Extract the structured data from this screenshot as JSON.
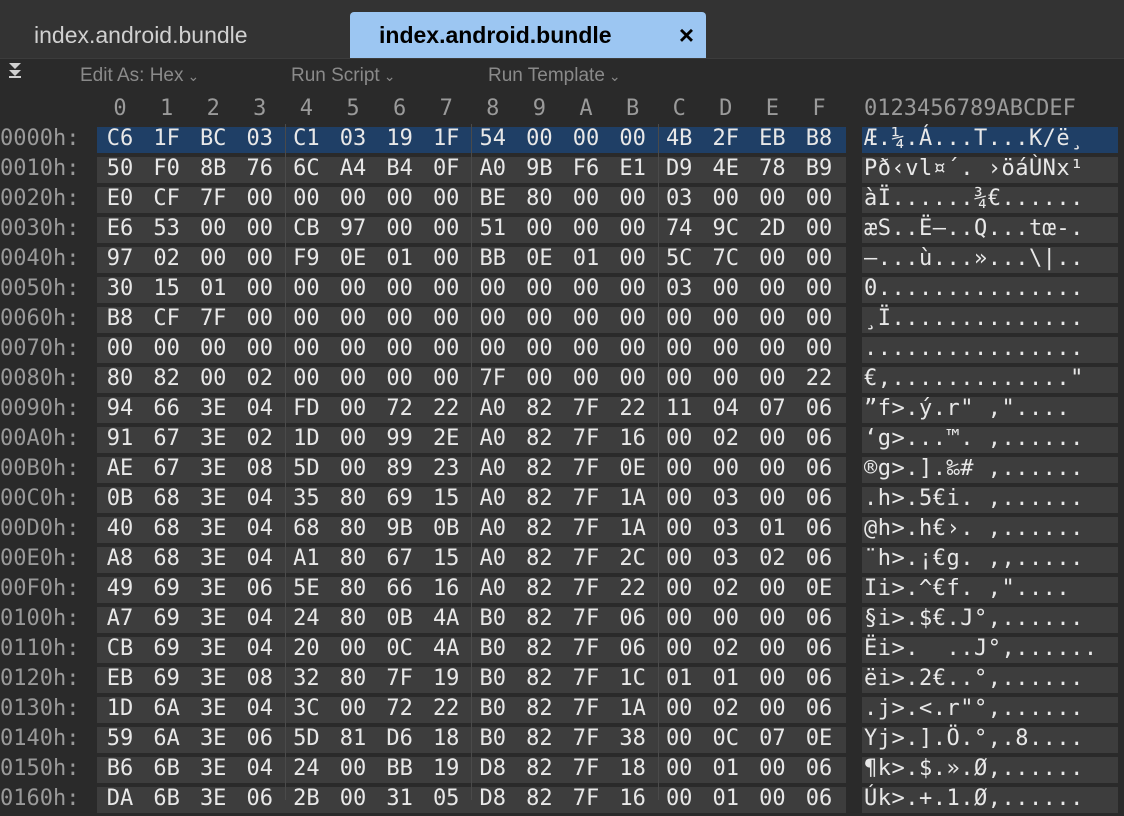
{
  "tabs": [
    {
      "label": "index.android.bundle",
      "active": false
    },
    {
      "label": "index.android.bundle",
      "active": true,
      "close": "×"
    }
  ],
  "toolbar": {
    "collapse_icon": "double-chevron-down-icon",
    "collapse_glyph": "⏬",
    "edit_as": "Edit As: Hex",
    "run_script": "Run Script",
    "run_template": "Run Template",
    "chevron": "⌄"
  },
  "columns": [
    "0",
    "1",
    "2",
    "3",
    "4",
    "5",
    "6",
    "7",
    "8",
    "9",
    "A",
    "B",
    "C",
    "D",
    "E",
    "F"
  ],
  "ascii_header": "0123456789ABCDEF",
  "rows": [
    {
      "addr": "0000h:",
      "bytes": [
        "C6",
        "1F",
        "BC",
        "03",
        "C1",
        "03",
        "19",
        "1F",
        "54",
        "00",
        "00",
        "00",
        "4B",
        "2F",
        "EB",
        "B8"
      ],
      "ascii": "Æ.¼.Á...T...K/ë¸",
      "selected": true
    },
    {
      "addr": "0010h:",
      "bytes": [
        "50",
        "F0",
        "8B",
        "76",
        "6C",
        "A4",
        "B4",
        "0F",
        "A0",
        "9B",
        "F6",
        "E1",
        "D9",
        "4E",
        "78",
        "B9"
      ],
      "ascii": "Pð‹vl¤´. ›öáÙNx¹"
    },
    {
      "addr": "0020h:",
      "bytes": [
        "E0",
        "CF",
        "7F",
        "00",
        "00",
        "00",
        "00",
        "00",
        "BE",
        "80",
        "00",
        "00",
        "03",
        "00",
        "00",
        "00"
      ],
      "ascii": "àÏ......¾€......"
    },
    {
      "addr": "0030h:",
      "bytes": [
        "E6",
        "53",
        "00",
        "00",
        "CB",
        "97",
        "00",
        "00",
        "51",
        "00",
        "00",
        "00",
        "74",
        "9C",
        "2D",
        "00"
      ],
      "ascii": "æS..Ë—..Q...tœ-."
    },
    {
      "addr": "0040h:",
      "bytes": [
        "97",
        "02",
        "00",
        "00",
        "F9",
        "0E",
        "01",
        "00",
        "BB",
        "0E",
        "01",
        "00",
        "5C",
        "7C",
        "00",
        "00"
      ],
      "ascii": "—...ù...»...\\|.."
    },
    {
      "addr": "0050h:",
      "bytes": [
        "30",
        "15",
        "01",
        "00",
        "00",
        "00",
        "00",
        "00",
        "00",
        "00",
        "00",
        "00",
        "03",
        "00",
        "00",
        "00"
      ],
      "ascii": "0..............."
    },
    {
      "addr": "0060h:",
      "bytes": [
        "B8",
        "CF",
        "7F",
        "00",
        "00",
        "00",
        "00",
        "00",
        "00",
        "00",
        "00",
        "00",
        "00",
        "00",
        "00",
        "00"
      ],
      "ascii": "¸Ï.............."
    },
    {
      "addr": "0070h:",
      "bytes": [
        "00",
        "00",
        "00",
        "00",
        "00",
        "00",
        "00",
        "00",
        "00",
        "00",
        "00",
        "00",
        "00",
        "00",
        "00",
        "00"
      ],
      "ascii": "................"
    },
    {
      "addr": "0080h:",
      "bytes": [
        "80",
        "82",
        "00",
        "02",
        "00",
        "00",
        "00",
        "00",
        "7F",
        "00",
        "00",
        "00",
        "00",
        "00",
        "00",
        "22"
      ],
      "ascii": "€,.............\""
    },
    {
      "addr": "0090h:",
      "bytes": [
        "94",
        "66",
        "3E",
        "04",
        "FD",
        "00",
        "72",
        "22",
        "A0",
        "82",
        "7F",
        "22",
        "11",
        "04",
        "07",
        "06"
      ],
      "ascii": "”f>.ý.r\" ,\"...."
    },
    {
      "addr": "00A0h:",
      "bytes": [
        "91",
        "67",
        "3E",
        "02",
        "1D",
        "00",
        "99",
        "2E",
        "A0",
        "82",
        "7F",
        "16",
        "00",
        "02",
        "00",
        "06"
      ],
      "ascii": "‘g>...™. ,......"
    },
    {
      "addr": "00B0h:",
      "bytes": [
        "AE",
        "67",
        "3E",
        "08",
        "5D",
        "00",
        "89",
        "23",
        "A0",
        "82",
        "7F",
        "0E",
        "00",
        "00",
        "00",
        "06"
      ],
      "ascii": "®g>.].‰# ,......"
    },
    {
      "addr": "00C0h:",
      "bytes": [
        "0B",
        "68",
        "3E",
        "04",
        "35",
        "80",
        "69",
        "15",
        "A0",
        "82",
        "7F",
        "1A",
        "00",
        "03",
        "00",
        "06"
      ],
      "ascii": ".h>.5€i. ,......"
    },
    {
      "addr": "00D0h:",
      "bytes": [
        "40",
        "68",
        "3E",
        "04",
        "68",
        "80",
        "9B",
        "0B",
        "A0",
        "82",
        "7F",
        "1A",
        "00",
        "03",
        "01",
        "06"
      ],
      "ascii": "@h>.h€›. ,......"
    },
    {
      "addr": "00E0h:",
      "bytes": [
        "A8",
        "68",
        "3E",
        "04",
        "A1",
        "80",
        "67",
        "15",
        "A0",
        "82",
        "7F",
        "2C",
        "00",
        "03",
        "02",
        "06"
      ],
      "ascii": "¨h>.¡€g. ,,....."
    },
    {
      "addr": "00F0h:",
      "bytes": [
        "49",
        "69",
        "3E",
        "06",
        "5E",
        "80",
        "66",
        "16",
        "A0",
        "82",
        "7F",
        "22",
        "00",
        "02",
        "00",
        "0E"
      ],
      "ascii": "Ii>.^€f. ,\"...."
    },
    {
      "addr": "0100h:",
      "bytes": [
        "A7",
        "69",
        "3E",
        "04",
        "24",
        "80",
        "0B",
        "4A",
        "B0",
        "82",
        "7F",
        "06",
        "00",
        "00",
        "00",
        "06"
      ],
      "ascii": "§i>.$€.J°,......"
    },
    {
      "addr": "0110h:",
      "bytes": [
        "CB",
        "69",
        "3E",
        "04",
        "20",
        "00",
        "0C",
        "4A",
        "B0",
        "82",
        "7F",
        "06",
        "00",
        "02",
        "00",
        "06"
      ],
      "ascii": "Ëi>.  ..J°,......"
    },
    {
      "addr": "0120h:",
      "bytes": [
        "EB",
        "69",
        "3E",
        "08",
        "32",
        "80",
        "7F",
        "19",
        "B0",
        "82",
        "7F",
        "1C",
        "01",
        "01",
        "00",
        "06"
      ],
      "ascii": "ëi>.2€..°,......"
    },
    {
      "addr": "0130h:",
      "bytes": [
        "1D",
        "6A",
        "3E",
        "04",
        "3C",
        "00",
        "72",
        "22",
        "B0",
        "82",
        "7F",
        "1A",
        "00",
        "02",
        "00",
        "06"
      ],
      "ascii": ".j>.<.r\"°,......"
    },
    {
      "addr": "0140h:",
      "bytes": [
        "59",
        "6A",
        "3E",
        "06",
        "5D",
        "81",
        "D6",
        "18",
        "B0",
        "82",
        "7F",
        "38",
        "00",
        "0C",
        "07",
        "0E"
      ],
      "ascii": "Yj>.].Ö.°,.8...."
    },
    {
      "addr": "0150h:",
      "bytes": [
        "B6",
        "6B",
        "3E",
        "04",
        "24",
        "00",
        "BB",
        "19",
        "D8",
        "82",
        "7F",
        "18",
        "00",
        "01",
        "00",
        "06"
      ],
      "ascii": "¶k>.$.».Ø,......"
    },
    {
      "addr": "0160h:",
      "bytes": [
        "DA",
        "6B",
        "3E",
        "06",
        "2B",
        "00",
        "31",
        "05",
        "D8",
        "82",
        "7F",
        "16",
        "00",
        "01",
        "00",
        "06"
      ],
      "ascii": "Úk>.+.1.Ø,......"
    }
  ]
}
